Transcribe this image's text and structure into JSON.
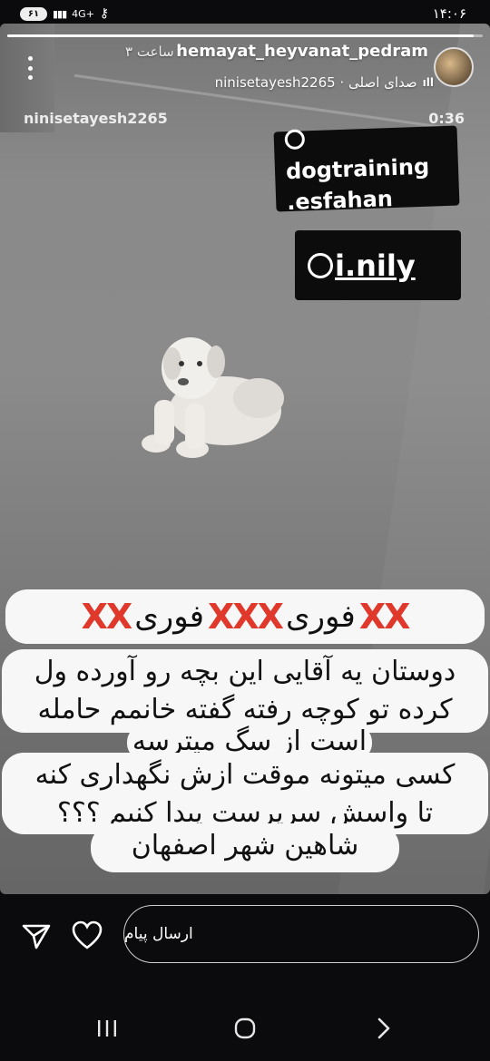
{
  "status_bar": {
    "time": "۱۴:۰۶",
    "battery": "۶۱",
    "network": "4G+"
  },
  "story": {
    "progress": 0.98,
    "username": "hemayat_heyvanat_pedram",
    "time_ago": "۳ ساعت",
    "audio_label": "ninisetayesh2265 · صدای اصلی",
    "watermark_user": "ninisetayesh2265",
    "duration": "0:36",
    "mentions": [
      {
        "line1": "dogtraining",
        "line2": ".esfahan"
      },
      {
        "line1": "i.nily"
      }
    ],
    "headline": {
      "word1": "فوری",
      "word2": "فوری",
      "marks_left": "XX",
      "marks_mid": "XXX",
      "marks_right": "XX"
    },
    "body_lines": {
      "l1": "دوستان یه آقایی این بچه رو آورده ول",
      "l2": "کرده تو کوچه رفته گفته خانمم حامله",
      "l3": "است از سگ میترسه",
      "l4": "کسی میتونه موقت ازش نگهداری کنه",
      "l5": "تا واسش سرپرست پیدا کنیم ؟؟؟",
      "l6": "شاهین شهر اصفهان"
    }
  },
  "bottom_bar": {
    "message_placeholder": "ارسال پیام"
  },
  "icons": {
    "send": "send-icon",
    "like": "heart-icon",
    "more": "more-vertical-icon",
    "nav_recent": "recent-apps-icon",
    "nav_home": "home-icon",
    "nav_back": "back-icon"
  }
}
